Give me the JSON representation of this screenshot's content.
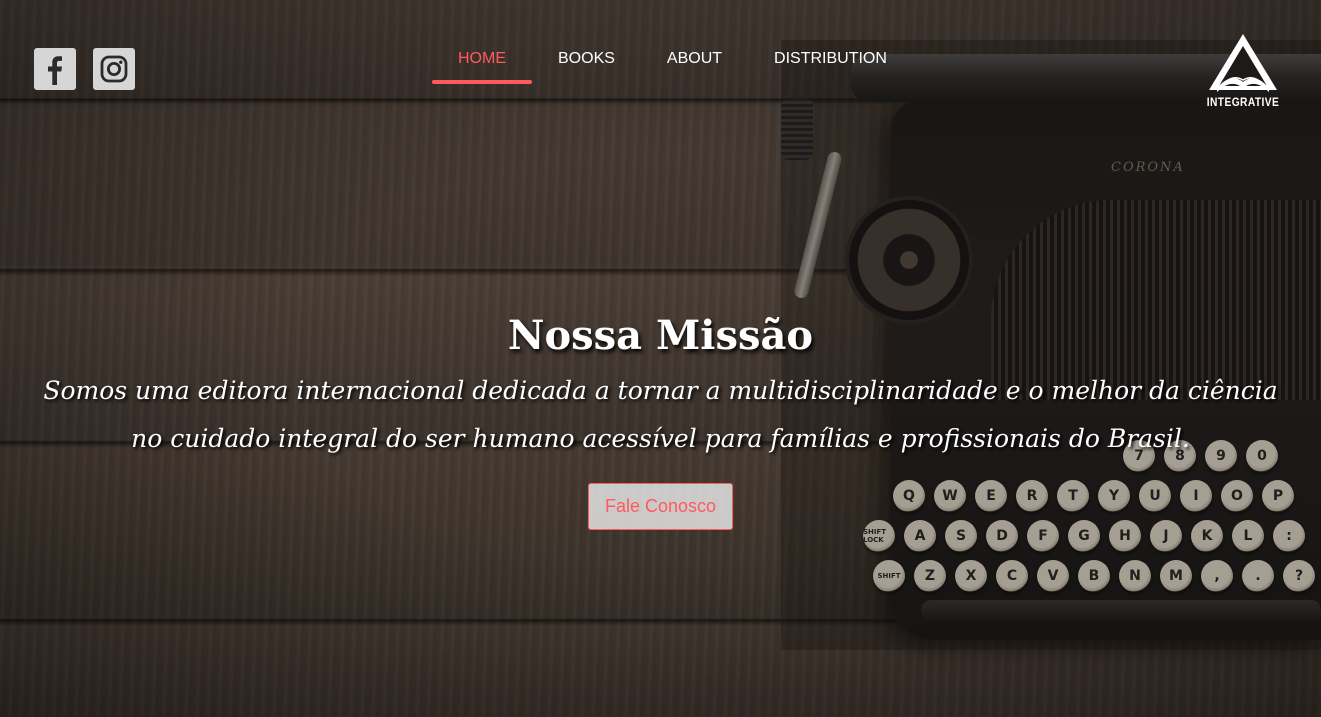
{
  "social": {
    "facebook_icon": "facebook-icon",
    "instagram_icon": "instagram-icon"
  },
  "nav": {
    "items": [
      {
        "label": "HOME",
        "active": true
      },
      {
        "label": "BOOKS",
        "active": false
      },
      {
        "label": "ABOUT",
        "active": false
      },
      {
        "label": "DISTRIBUTION",
        "active": false
      }
    ]
  },
  "logo": {
    "text": "INTEGRATIVE",
    "icon": "book-pyramid-logo"
  },
  "hero": {
    "title": "Nossa Missão",
    "text": "Somos uma editora internacional dedicada a tornar a multidisciplinaridade e o melhor da ciência no cuidado integral do ser humano acessível para famílias e profissionais do Brasil.",
    "cta_label": "Fale Conosco"
  },
  "typewriter": {
    "brand": "CORONA",
    "keys": {
      "row_numbers": [
        "7",
        "8",
        "9",
        "0"
      ],
      "row_top": [
        "Q",
        "W",
        "E",
        "R",
        "T",
        "Y",
        "U",
        "I",
        "O",
        "P"
      ],
      "row_middle": [
        "SHIFT LOCK",
        "A",
        "S",
        "D",
        "F",
        "G",
        "H",
        "J",
        "K",
        "L",
        ":"
      ],
      "row_bottom": [
        "SHIFT",
        "Z",
        "X",
        "C",
        "V",
        "B",
        "N",
        "M",
        ",",
        ".",
        "?"
      ]
    }
  },
  "colors": {
    "accent": "#ff5a5f",
    "text": "#ffffff",
    "social_bg": "#d6d6d6"
  }
}
